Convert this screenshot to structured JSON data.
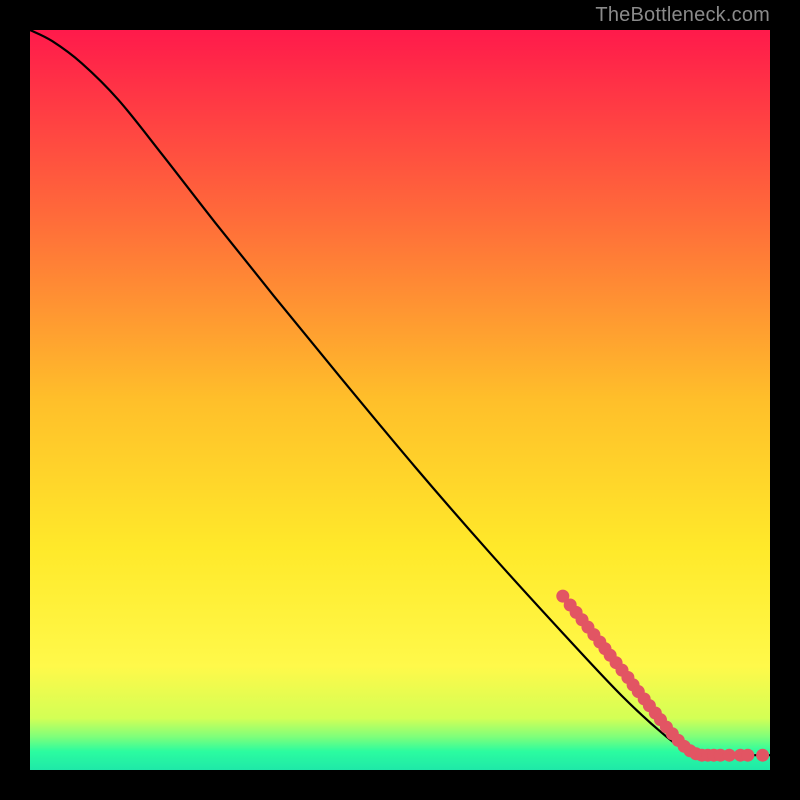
{
  "watermark": "TheBottleneck.com",
  "chart_data": {
    "type": "line",
    "title": "",
    "xlabel": "",
    "ylabel": "",
    "xlim": [
      0,
      100
    ],
    "ylim": [
      0,
      100
    ],
    "grid": false,
    "legend": false,
    "background_gradient": {
      "stops": [
        {
          "pos": 0.0,
          "color": "#ff1a4b"
        },
        {
          "pos": 0.25,
          "color": "#ff6a3a"
        },
        {
          "pos": 0.5,
          "color": "#ffbf2a"
        },
        {
          "pos": 0.7,
          "color": "#ffe92a"
        },
        {
          "pos": 0.86,
          "color": "#fff94a"
        },
        {
          "pos": 0.93,
          "color": "#d3ff55"
        },
        {
          "pos": 0.955,
          "color": "#7fff7a"
        },
        {
          "pos": 0.975,
          "color": "#2bfca0"
        },
        {
          "pos": 1.0,
          "color": "#1fe8a8"
        }
      ]
    },
    "series": [
      {
        "name": "curve",
        "type": "line",
        "color": "#000000",
        "points": [
          {
            "x": 0.0,
            "y": 100.0
          },
          {
            "x": 3.0,
            "y": 98.5
          },
          {
            "x": 7.0,
            "y": 95.5
          },
          {
            "x": 12.0,
            "y": 90.5
          },
          {
            "x": 18.0,
            "y": 83.0
          },
          {
            "x": 25.0,
            "y": 74.0
          },
          {
            "x": 33.0,
            "y": 64.0
          },
          {
            "x": 42.0,
            "y": 53.0
          },
          {
            "x": 52.0,
            "y": 41.0
          },
          {
            "x": 62.0,
            "y": 29.5
          },
          {
            "x": 72.0,
            "y": 18.5
          },
          {
            "x": 80.0,
            "y": 10.0
          },
          {
            "x": 86.0,
            "y": 4.5
          },
          {
            "x": 89.0,
            "y": 2.5
          },
          {
            "x": 91.0,
            "y": 2.0
          },
          {
            "x": 95.0,
            "y": 2.0
          },
          {
            "x": 100.0,
            "y": 2.0
          }
        ]
      },
      {
        "name": "highlight-dots",
        "type": "scatter",
        "color": "#e25563",
        "points": [
          {
            "x": 72.0,
            "y": 23.5
          },
          {
            "x": 73.0,
            "y": 22.3
          },
          {
            "x": 73.8,
            "y": 21.3
          },
          {
            "x": 74.6,
            "y": 20.3
          },
          {
            "x": 75.4,
            "y": 19.3
          },
          {
            "x": 76.2,
            "y": 18.3
          },
          {
            "x": 77.0,
            "y": 17.3
          },
          {
            "x": 77.7,
            "y": 16.4
          },
          {
            "x": 78.4,
            "y": 15.5
          },
          {
            "x": 79.2,
            "y": 14.5
          },
          {
            "x": 80.0,
            "y": 13.5
          },
          {
            "x": 80.8,
            "y": 12.5
          },
          {
            "x": 81.5,
            "y": 11.5
          },
          {
            "x": 82.2,
            "y": 10.6
          },
          {
            "x": 83.0,
            "y": 9.6
          },
          {
            "x": 83.7,
            "y": 8.7
          },
          {
            "x": 84.5,
            "y": 7.7
          },
          {
            "x": 85.2,
            "y": 6.8
          },
          {
            "x": 86.0,
            "y": 5.8
          },
          {
            "x": 86.8,
            "y": 4.9
          },
          {
            "x": 87.6,
            "y": 4.0
          },
          {
            "x": 88.4,
            "y": 3.2
          },
          {
            "x": 89.2,
            "y": 2.6
          },
          {
            "x": 90.0,
            "y": 2.2
          },
          {
            "x": 90.8,
            "y": 2.0
          },
          {
            "x": 91.6,
            "y": 2.0
          },
          {
            "x": 92.4,
            "y": 2.0
          },
          {
            "x": 93.3,
            "y": 2.0
          },
          {
            "x": 94.5,
            "y": 2.0
          },
          {
            "x": 96.0,
            "y": 2.0
          },
          {
            "x": 97.0,
            "y": 2.0
          },
          {
            "x": 99.0,
            "y": 2.0
          }
        ]
      }
    ]
  }
}
